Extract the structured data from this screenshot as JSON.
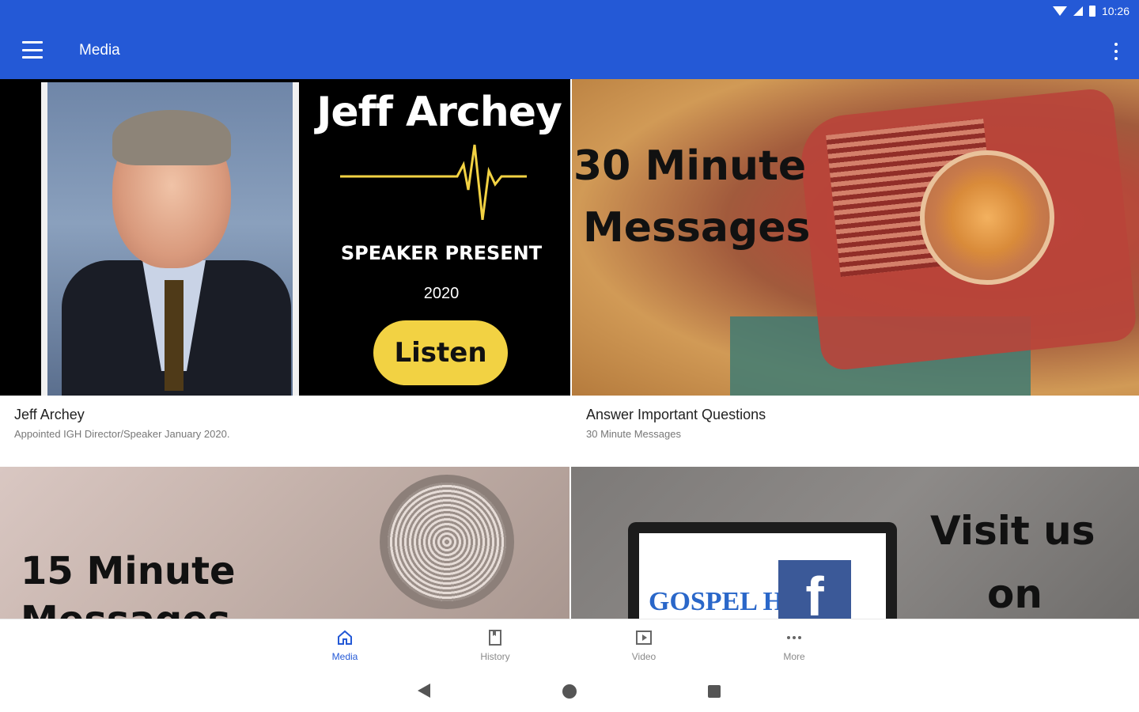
{
  "status_bar": {
    "time": "10:26"
  },
  "app_bar": {
    "title": "Media",
    "menu_icon": "hamburger-menu-icon",
    "overflow_icon": "more-vert-icon"
  },
  "cards": [
    {
      "artwork": {
        "name": "Jeff Archey",
        "subtitle": "SPEAKER PRESENT",
        "year": "2020",
        "button": "Listen"
      },
      "title": "Jeff Archey",
      "subtitle": "Appointed IGH Director/Speaker January 2020."
    },
    {
      "artwork": {
        "line1": "30 Minute",
        "line2": "Messages"
      },
      "title": "Answer Important Questions",
      "subtitle": "30 Minute Messages"
    },
    {
      "artwork": {
        "line1": "15 Minute",
        "line2": "Messages"
      }
    },
    {
      "artwork": {
        "logo_text": "GOSPEL HOUR",
        "fb_letter": "f",
        "line1": "Visit us",
        "line2": "on"
      }
    }
  ],
  "bottom_nav": {
    "items": [
      {
        "label": "Media",
        "icon": "home-icon",
        "active": true
      },
      {
        "label": "History",
        "icon": "bookmark-icon",
        "active": false
      },
      {
        "label": "Video",
        "icon": "play-video-icon",
        "active": false
      },
      {
        "label": "More",
        "icon": "more-horiz-icon",
        "active": false
      }
    ]
  },
  "colors": {
    "primary": "#2459d6",
    "accent_yellow": "#f2d243"
  }
}
